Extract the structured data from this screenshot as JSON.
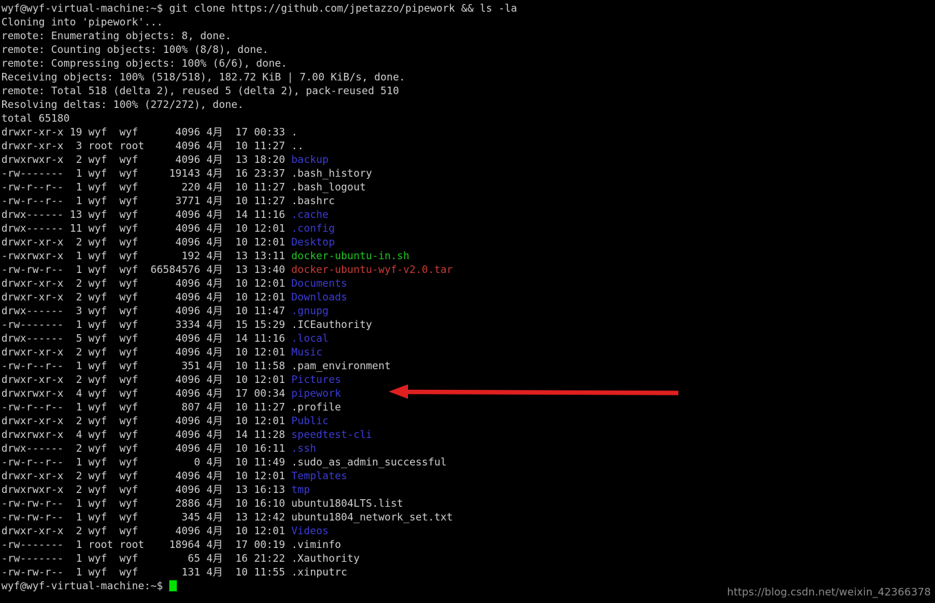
{
  "terminal": {
    "background_color": "#000000",
    "foreground_color": "#d0d0d0",
    "dir_color": "#3c3cd8",
    "exec_color": "#1ec81e",
    "archive_color": "#cc3b36",
    "cursor_color": "#00e000",
    "prompt": "wyf@wyf-virtual-machine:~$",
    "command": " git clone https://github.com/jpetazzo/pipework && ls -la",
    "output_lines": [
      "Cloning into 'pipework'...",
      "remote: Enumerating objects: 8, done.",
      "remote: Counting objects: 100% (8/8), done.",
      "remote: Compressing objects: 100% (6/6), done.",
      "Receiving objects: 100% (518/518), 182.72 KiB | 7.00 KiB/s, done.",
      "remote: Total 518 (delta 2), reused 5 (delta 2), pack-reused 510",
      "Resolving deltas: 100% (272/272), done.",
      "total 65180"
    ],
    "listing": [
      {
        "perm": "drwxr-xr-x",
        "links": "19",
        "owner": "wyf",
        "group": "wyf",
        "size": "4096",
        "month": "4月",
        "day": "17",
        "time": "00:33",
        "name": ".",
        "kind": "plain"
      },
      {
        "perm": "drwxr-xr-x",
        "links": "3",
        "owner": "root",
        "group": "root",
        "size": "4096",
        "month": "4月",
        "day": "10",
        "time": "11:27",
        "name": "..",
        "kind": "plain"
      },
      {
        "perm": "drwxrwxr-x",
        "links": "2",
        "owner": "wyf",
        "group": "wyf",
        "size": "4096",
        "month": "4月",
        "day": "13",
        "time": "18:20",
        "name": "backup",
        "kind": "dir"
      },
      {
        "perm": "-rw-------",
        "links": "1",
        "owner": "wyf",
        "group": "wyf",
        "size": "19143",
        "month": "4月",
        "day": "16",
        "time": "23:37",
        "name": ".bash_history",
        "kind": "plain"
      },
      {
        "perm": "-rw-r--r--",
        "links": "1",
        "owner": "wyf",
        "group": "wyf",
        "size": "220",
        "month": "4月",
        "day": "10",
        "time": "11:27",
        "name": ".bash_logout",
        "kind": "plain"
      },
      {
        "perm": "-rw-r--r--",
        "links": "1",
        "owner": "wyf",
        "group": "wyf",
        "size": "3771",
        "month": "4月",
        "day": "10",
        "time": "11:27",
        "name": ".bashrc",
        "kind": "plain"
      },
      {
        "perm": "drwx------",
        "links": "13",
        "owner": "wyf",
        "group": "wyf",
        "size": "4096",
        "month": "4月",
        "day": "14",
        "time": "11:16",
        "name": ".cache",
        "kind": "dir"
      },
      {
        "perm": "drwx------",
        "links": "11",
        "owner": "wyf",
        "group": "wyf",
        "size": "4096",
        "month": "4月",
        "day": "10",
        "time": "12:01",
        "name": ".config",
        "kind": "dir"
      },
      {
        "perm": "drwxr-xr-x",
        "links": "2",
        "owner": "wyf",
        "group": "wyf",
        "size": "4096",
        "month": "4月",
        "day": "10",
        "time": "12:01",
        "name": "Desktop",
        "kind": "dir"
      },
      {
        "perm": "-rwxrwxr-x",
        "links": "1",
        "owner": "wyf",
        "group": "wyf",
        "size": "192",
        "month": "4月",
        "day": "13",
        "time": "13:11",
        "name": "docker-ubuntu-in.sh",
        "kind": "exec"
      },
      {
        "perm": "-rw-rw-r--",
        "links": "1",
        "owner": "wyf",
        "group": "wyf",
        "size": "66584576",
        "month": "4月",
        "day": "13",
        "time": "13:40",
        "name": "docker-ubuntu-wyf-v2.0.tar",
        "kind": "archive"
      },
      {
        "perm": "drwxr-xr-x",
        "links": "2",
        "owner": "wyf",
        "group": "wyf",
        "size": "4096",
        "month": "4月",
        "day": "10",
        "time": "12:01",
        "name": "Documents",
        "kind": "dir"
      },
      {
        "perm": "drwxr-xr-x",
        "links": "2",
        "owner": "wyf",
        "group": "wyf",
        "size": "4096",
        "month": "4月",
        "day": "10",
        "time": "12:01",
        "name": "Downloads",
        "kind": "dir"
      },
      {
        "perm": "drwx------",
        "links": "3",
        "owner": "wyf",
        "group": "wyf",
        "size": "4096",
        "month": "4月",
        "day": "10",
        "time": "11:47",
        "name": ".gnupg",
        "kind": "dir"
      },
      {
        "perm": "-rw-------",
        "links": "1",
        "owner": "wyf",
        "group": "wyf",
        "size": "3334",
        "month": "4月",
        "day": "15",
        "time": "15:29",
        "name": ".ICEauthority",
        "kind": "plain"
      },
      {
        "perm": "drwx------",
        "links": "5",
        "owner": "wyf",
        "group": "wyf",
        "size": "4096",
        "month": "4月",
        "day": "14",
        "time": "11:16",
        "name": ".local",
        "kind": "dir"
      },
      {
        "perm": "drwxr-xr-x",
        "links": "2",
        "owner": "wyf",
        "group": "wyf",
        "size": "4096",
        "month": "4月",
        "day": "10",
        "time": "12:01",
        "name": "Music",
        "kind": "dir"
      },
      {
        "perm": "-rw-r--r--",
        "links": "1",
        "owner": "wyf",
        "group": "wyf",
        "size": "351",
        "month": "4月",
        "day": "10",
        "time": "11:58",
        "name": ".pam_environment",
        "kind": "plain"
      },
      {
        "perm": "drwxr-xr-x",
        "links": "2",
        "owner": "wyf",
        "group": "wyf",
        "size": "4096",
        "month": "4月",
        "day": "10",
        "time": "12:01",
        "name": "Pictures",
        "kind": "dir"
      },
      {
        "perm": "drwxrwxr-x",
        "links": "4",
        "owner": "wyf",
        "group": "wyf",
        "size": "4096",
        "month": "4月",
        "day": "17",
        "time": "00:34",
        "name": "pipework",
        "kind": "dir"
      },
      {
        "perm": "-rw-r--r--",
        "links": "1",
        "owner": "wyf",
        "group": "wyf",
        "size": "807",
        "month": "4月",
        "day": "10",
        "time": "11:27",
        "name": ".profile",
        "kind": "plain"
      },
      {
        "perm": "drwxr-xr-x",
        "links": "2",
        "owner": "wyf",
        "group": "wyf",
        "size": "4096",
        "month": "4月",
        "day": "10",
        "time": "12:01",
        "name": "Public",
        "kind": "dir"
      },
      {
        "perm": "drwxrwxr-x",
        "links": "4",
        "owner": "wyf",
        "group": "wyf",
        "size": "4096",
        "month": "4月",
        "day": "14",
        "time": "11:28",
        "name": "speedtest-cli",
        "kind": "dir"
      },
      {
        "perm": "drwx------",
        "links": "2",
        "owner": "wyf",
        "group": "wyf",
        "size": "4096",
        "month": "4月",
        "day": "10",
        "time": "16:11",
        "name": ".ssh",
        "kind": "dir"
      },
      {
        "perm": "-rw-r--r--",
        "links": "1",
        "owner": "wyf",
        "group": "wyf",
        "size": "0",
        "month": "4月",
        "day": "10",
        "time": "11:49",
        "name": ".sudo_as_admin_successful",
        "kind": "plain"
      },
      {
        "perm": "drwxr-xr-x",
        "links": "2",
        "owner": "wyf",
        "group": "wyf",
        "size": "4096",
        "month": "4月",
        "day": "10",
        "time": "12:01",
        "name": "Templates",
        "kind": "dir"
      },
      {
        "perm": "drwxrwxr-x",
        "links": "2",
        "owner": "wyf",
        "group": "wyf",
        "size": "4096",
        "month": "4月",
        "day": "13",
        "time": "16:13",
        "name": "tmp",
        "kind": "dir"
      },
      {
        "perm": "-rw-rw-r--",
        "links": "1",
        "owner": "wyf",
        "group": "wyf",
        "size": "2886",
        "month": "4月",
        "day": "10",
        "time": "16:10",
        "name": "ubuntu1804LTS.list",
        "kind": "plain"
      },
      {
        "perm": "-rw-rw-r--",
        "links": "1",
        "owner": "wyf",
        "group": "wyf",
        "size": "345",
        "month": "4月",
        "day": "13",
        "time": "12:42",
        "name": "ubuntu1804_network_set.txt",
        "kind": "plain"
      },
      {
        "perm": "drwxr-xr-x",
        "links": "2",
        "owner": "wyf",
        "group": "wyf",
        "size": "4096",
        "month": "4月",
        "day": "10",
        "time": "12:01",
        "name": "Videos",
        "kind": "dir"
      },
      {
        "perm": "-rw-------",
        "links": "1",
        "owner": "root",
        "group": "root",
        "size": "18964",
        "month": "4月",
        "day": "17",
        "time": "00:19",
        "name": ".viminfo",
        "kind": "plain"
      },
      {
        "perm": "-rw-------",
        "links": "1",
        "owner": "wyf",
        "group": "wyf",
        "size": "65",
        "month": "4月",
        "day": "16",
        "time": "21:22",
        "name": ".Xauthority",
        "kind": "plain"
      },
      {
        "perm": "-rw-rw-r--",
        "links": "1",
        "owner": "wyf",
        "group": "wyf",
        "size": "131",
        "month": "4月",
        "day": "10",
        "time": "11:55",
        "name": ".xinputrc",
        "kind": "plain"
      }
    ],
    "final_prompt": "wyf@wyf-virtual-machine:~$"
  },
  "annotation": {
    "arrow_color": "#e02020",
    "points_at": "pipework"
  },
  "watermark": {
    "text": "https://blog.csdn.net/weixin_42366378"
  }
}
